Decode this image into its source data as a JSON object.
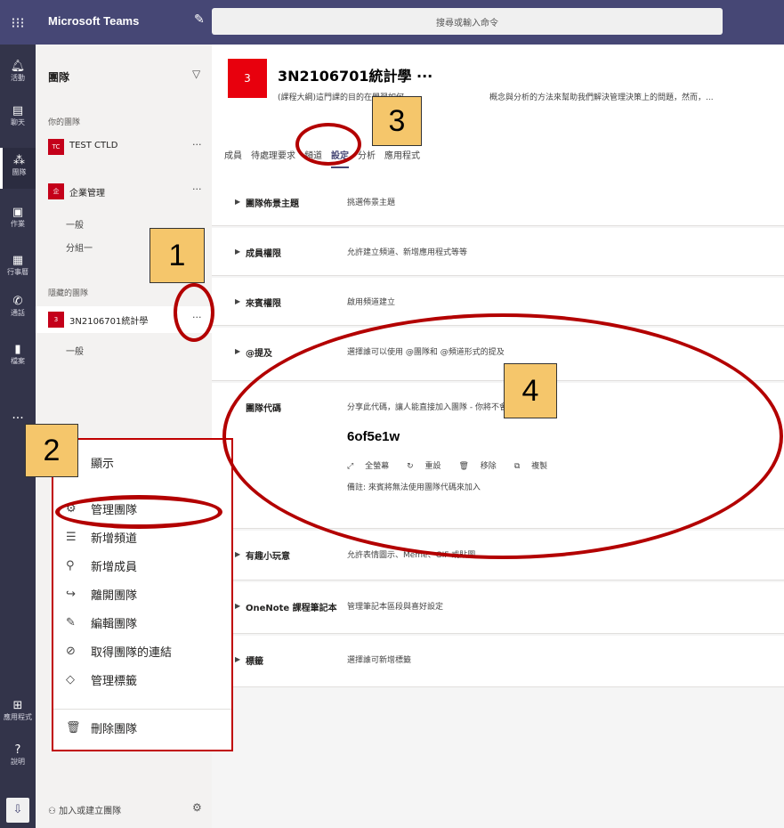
{
  "app": {
    "title": "Microsoft Teams",
    "search_placeholder": "搜尋或輸入命令"
  },
  "rail": [
    {
      "label": "活動",
      "icon": "bell-icon"
    },
    {
      "label": "聊天",
      "icon": "chat-icon"
    },
    {
      "label": "團隊",
      "icon": "teams-icon"
    },
    {
      "label": "作業",
      "icon": "assignments-icon"
    },
    {
      "label": "行事曆",
      "icon": "calendar-icon"
    },
    {
      "label": "通話",
      "icon": "phone-icon"
    },
    {
      "label": "檔案",
      "icon": "file-icon"
    }
  ],
  "rail_bottom": [
    {
      "label": "應用程式",
      "icon": "apps-icon"
    },
    {
      "label": "說明",
      "icon": "help-icon"
    }
  ],
  "rail_more": "...",
  "teamlist": {
    "title": "團隊",
    "section_your": "你的團隊",
    "section_hidden": "隱藏的團隊",
    "teams": [
      {
        "name": "TEST CTLD",
        "avatar": "TC"
      },
      {
        "name": "企業管理",
        "avatar": "企",
        "channels": [
          "一般",
          "分組一"
        ]
      },
      {
        "name": "3N2106701統計學",
        "avatar": "3",
        "channels": [
          "一般"
        ]
      }
    ],
    "more": "···",
    "join_label": "加入或建立團隊"
  },
  "menu": {
    "items": [
      {
        "label": "顯示",
        "icon": "chevron-up-icon"
      },
      {
        "label": "管理團隊",
        "icon": "gear-icon"
      },
      {
        "label": "新增頻道",
        "icon": "channel-icon"
      },
      {
        "label": "新增成員",
        "icon": "add-person-icon"
      },
      {
        "label": "離開團隊",
        "icon": "leave-icon"
      },
      {
        "label": "編輯團隊",
        "icon": "pencil-icon"
      },
      {
        "label": "取得團隊的連結",
        "icon": "link-icon"
      },
      {
        "label": "管理標籤",
        "icon": "tag-icon"
      },
      {
        "label": "刪除團隊",
        "icon": "trash-icon"
      }
    ]
  },
  "header": {
    "avatar": "3",
    "title": "3N2106701統計學 ···",
    "desc": "(課程大綱)這門課的目的在學習如何",
    "desc_end": "概念與分析的方法來幫助我們解決管理決策上的問題，然而，...",
    "tabs": [
      "成員",
      "待處理要求",
      "頻道",
      "設定",
      "分析",
      "應用程式"
    ],
    "active_tab": "設定"
  },
  "settings": [
    {
      "name": "團隊佈景主題",
      "desc": "挑選佈景主題"
    },
    {
      "name": "成員權限",
      "desc": "允許建立頻道、新增應用程式等等"
    },
    {
      "name": "來賓權限",
      "desc": "啟用頻道建立"
    },
    {
      "name": "@提及",
      "desc": "選擇誰可以使用 @團隊和 @頻道形式的提及"
    },
    {
      "name": "團隊代碼",
      "desc": "分享此代碼，讓人能直接加入團隊 - 你將不會收到加入"
    },
    {
      "name": "有趣小玩意",
      "desc": "允許表情圖示、Meme、GIF 或貼圖"
    },
    {
      "name": "OneNote 課程筆記本",
      "desc": "管理筆記本區段與喜好設定"
    },
    {
      "name": "標籤",
      "desc": "選擇誰可新增標籤"
    }
  ],
  "team_code": {
    "value": "6of5e1w",
    "actions": [
      "全螢幕",
      "重設",
      "移除",
      "複製"
    ],
    "note": "備註: 來賓將無法使用團隊代碼來加入"
  },
  "annotations": [
    "1",
    "2",
    "3",
    "4"
  ],
  "colors": {
    "top_bar": "#464775",
    "rail": "#33344a",
    "accent": "#c4001a",
    "annotation_fill": "#f5c66b",
    "annotation_ring": "#b30000"
  }
}
